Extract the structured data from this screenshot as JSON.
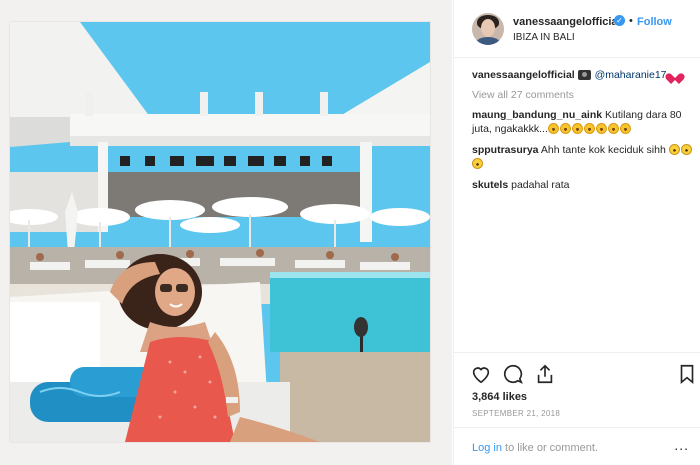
{
  "post": {
    "username": "vanessaangelofficial",
    "follow_label": "Follow",
    "separator": "•",
    "location": "IBIZA IN BALI",
    "caption_user": "vanessaangelofficial",
    "caption_mention": "@maharanie17",
    "view_all": "View all 27 comments",
    "comments": [
      {
        "user": "maung_bandung_nu_aink",
        "text": "Kutilang dara 80 juta, ngakakkk..."
      },
      {
        "user": "spputrasurya",
        "text": "Ahh tante kok keciduk sihh"
      },
      {
        "user": "skutels",
        "text": "padahal rata"
      }
    ],
    "likes": "3,864 likes",
    "date": "SEPTEMBER 21, 2018",
    "login_link": "Log in",
    "login_rest": " to like or comment.",
    "more": "..."
  },
  "icons": {
    "verified": "verified-badge-icon",
    "like": "heart-icon",
    "comment": "comment-bubble-icon",
    "share": "share-icon",
    "save": "bookmark-icon"
  },
  "colors": {
    "accent": "#3897f0",
    "sky": "#5dc6ee",
    "pool": "#3ec3d6",
    "dress": "#e8584c"
  }
}
